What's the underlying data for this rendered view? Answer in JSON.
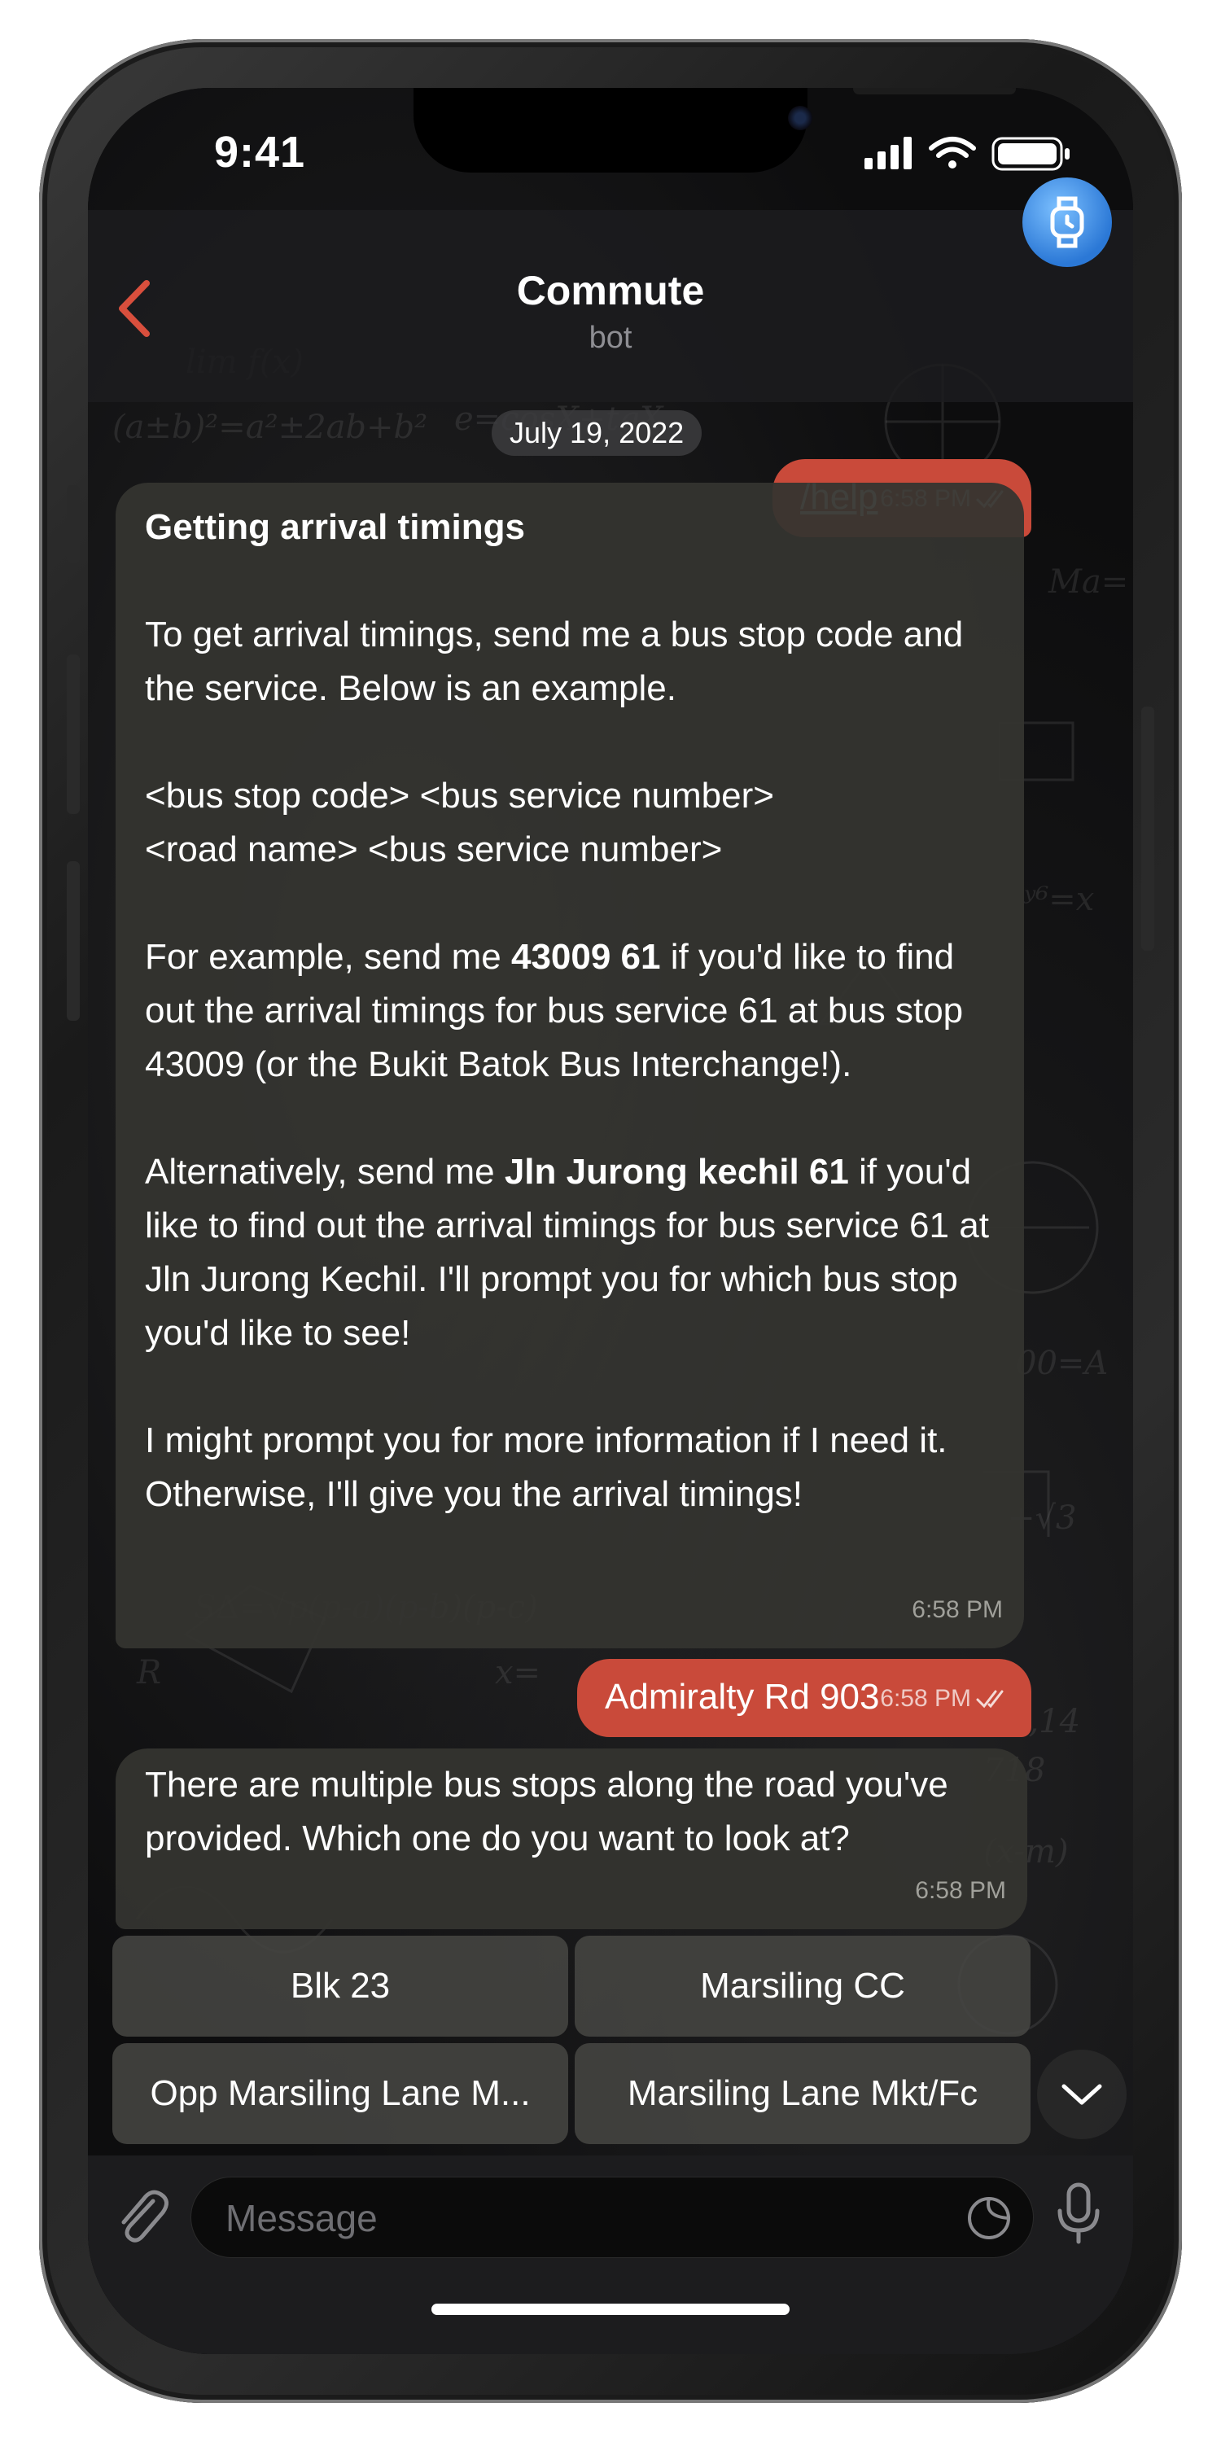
{
  "status_bar": {
    "time": "9:41"
  },
  "header": {
    "title": "Commute",
    "subtitle": "bot"
  },
  "date_chip": "July 19, 2022",
  "messages": [
    {
      "direction": "out",
      "text": "/help",
      "time": "6:58 PM",
      "status": "read"
    },
    {
      "direction": "in",
      "title": "Getting arrival timings",
      "p1": "To get arrival timings, send me a bus stop code and the service. Below is an example.",
      "p2_line1": "<bus stop code> <bus service number>",
      "p2_line2": "<road name> <bus service number>",
      "p3_pre": "For example, send me ",
      "p3_bold": "43009 61",
      "p3_post": " if you'd like to find out the arrival timings for bus service 61 at bus stop 43009 (or the Bukit Batok Bus Interchange!).",
      "p4_pre": "Alternatively, send me ",
      "p4_bold": "Jln Jurong kechil 61",
      "p4_post": " if you'd like to find out the arrival timings for bus service 61 at Jln Jurong Kechil. I'll prompt you for which bus stop you'd like to see!",
      "p5": "I might prompt you for more information if I need it. Otherwise, I'll give you the arrival timings!",
      "time": "6:58 PM"
    },
    {
      "direction": "out",
      "text": "Admiralty Rd 903",
      "time": "6:58 PM",
      "status": "read"
    },
    {
      "direction": "in",
      "text": "There are multiple bus stops along the road you've provided. Which one do you want to look at?",
      "time": "6:58 PM"
    }
  ],
  "keyboard_buttons": [
    "Blk 23",
    "Marsiling CC",
    "Opp Marsiling Lane M...",
    "Marsiling Lane Mkt/Fc"
  ],
  "composer": {
    "placeholder": "Message"
  },
  "colors": {
    "accent": "#c94a3a",
    "incoming_bubble": "#343430",
    "background": "#0d0d0e",
    "avatar": "#2b78d6"
  },
  "icons": [
    "back-chevron-icon",
    "watch-icon",
    "double-check-icon",
    "attach-icon",
    "sticker-icon",
    "mic-icon",
    "chevron-down-icon",
    "signal-icon",
    "wifi-icon",
    "battery-icon"
  ]
}
